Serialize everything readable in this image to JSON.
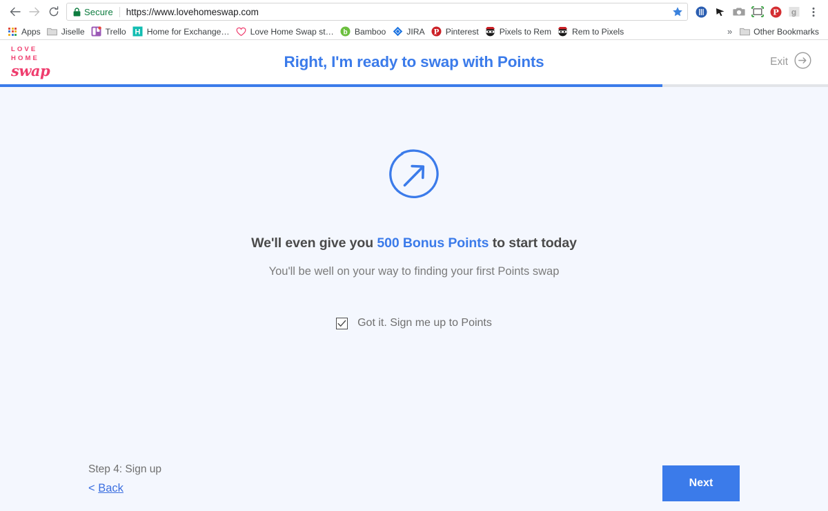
{
  "browser": {
    "nav": {
      "back_icon": "arrow-left-icon",
      "forward_icon": "arrow-right-icon",
      "reload_icon": "reload-icon"
    },
    "omnibox": {
      "lock_icon": "lock-icon",
      "security_label": "Secure",
      "url": "https://www.lovehomeswap.com",
      "star_icon": "star-icon"
    },
    "extensions": [
      {
        "name": "blue-circle-extension-icon",
        "color": "#2a5db0"
      },
      {
        "name": "cursor-extension-icon",
        "color": "#1a1a1a"
      },
      {
        "name": "camera-extension-icon",
        "color": "#9e9e9e"
      },
      {
        "name": "screenshot-crop-extension-icon",
        "color": "#3fa347"
      },
      {
        "name": "pinterest-extension-icon",
        "color": "#d42d31"
      },
      {
        "name": "google-extension-icon",
        "color": "#a0a0a0"
      },
      {
        "name": "chrome-menu-icon",
        "color": "#5f6368"
      }
    ],
    "bookmarks": [
      {
        "label": "Apps",
        "icon": "apps-grid-icon"
      },
      {
        "label": "Jiselle",
        "icon": "folder-icon"
      },
      {
        "label": "Trello",
        "icon": "trello-icon"
      },
      {
        "label": "Home for Exchange…",
        "icon": "h-square-icon"
      },
      {
        "label": "Love Home Swap st…",
        "icon": "heart-icon"
      },
      {
        "label": "Bamboo",
        "icon": "bamboo-icon"
      },
      {
        "label": "JIRA",
        "icon": "jira-diamond-icon"
      },
      {
        "label": "Pinterest",
        "icon": "pinterest-icon"
      },
      {
        "label": "Pixels to Rem",
        "icon": "ninja-icon"
      },
      {
        "label": "Rem to Pixels",
        "icon": "ninja-icon"
      }
    ],
    "bookmark_overflow": "»",
    "other_bookmarks": {
      "label": "Other Bookmarks",
      "icon": "folder-icon"
    }
  },
  "site": {
    "logo": {
      "line1": "LOVE",
      "line2": "HOME",
      "script": "swap",
      "color": "#ef3d6e"
    },
    "header_title": "Right, I'm ready to swap with Points",
    "exit": {
      "label": "Exit",
      "icon": "arrow-right-circle-icon"
    },
    "progress": {
      "percent": 80,
      "fill_color": "#3b7bea",
      "track_color": "#e2e4e8"
    }
  },
  "main": {
    "hero_icon": "circle-arrow-up-right-icon",
    "headline_prefix": "We'll even give you ",
    "headline_accent": "500 Bonus Points",
    "headline_suffix": " to start today",
    "subline": "You'll be well on your way to finding your first Points swap",
    "checkbox": {
      "label": "Got it. Sign me up to Points",
      "checked": true
    }
  },
  "footer": {
    "step_label": "Step 4: Sign up",
    "back_prefix": "< ",
    "back_label": "Back",
    "next_label": "Next"
  },
  "colors": {
    "accent_blue": "#3b7bea",
    "brand_pink": "#ef3d6e",
    "page_background": "#f4f7fe",
    "secure_green": "#0d7c3f"
  }
}
